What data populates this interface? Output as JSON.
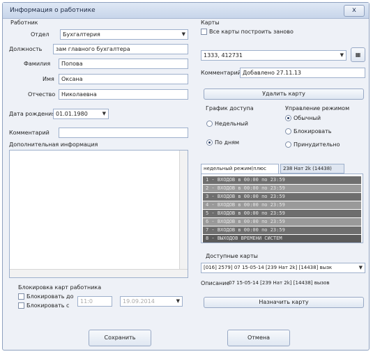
{
  "window": {
    "title": "Информация о работнике",
    "close_label": "x"
  },
  "left": {
    "section_label": "Работник",
    "department_label": "Отдел",
    "department_value": "Бухгалтерия",
    "position_label": "Должность",
    "position_value": "зам главного бухгалтера",
    "surname_label": "Фамилия",
    "surname_value": "Попова",
    "name_label": "Имя",
    "name_value": "Оксана",
    "patronymic_label": "Отчество",
    "patronymic_value": "Николаевна",
    "birthdate_label": "Дата рождения",
    "birthdate_value": "01.01.1980",
    "comment_label": "Комментарий",
    "comment_value": "",
    "extra_info_label": "Дополнительная информация",
    "extra_info_value": "",
    "block_section_label": "Блокировка карт работника",
    "block_until_label": "Блокировать до",
    "block_from_label": "Блокировать с",
    "block_time": "11:0",
    "block_date": "19.09.2014"
  },
  "right": {
    "cards_label": "Карты",
    "show_all_label": "Все карты построить заново",
    "card_value": "1333, 412731",
    "comment_label": "Комментарий",
    "comment_value": "Добавлено 27.11.13",
    "remove_card_label": "Удалить карту",
    "access_label": "График доступа",
    "radio_weekly_label": "Недельный",
    "radio_daily_label": "По дням",
    "control_label": "Управление режимом",
    "radio_normal_label": "Обычный",
    "radio_block_label": "Блокировать",
    "radio_free_label": "Принудительно",
    "tab1_label": "недельный режим(плюс",
    "tab2_label": "238 Нат 2k (14438)",
    "schedule_rows": [
      "1 - ВХОДОВ в 00:00 по 23:59",
      "2 - ВХОДОВ в 00:00 по 23:59",
      "3 - ВХОДОВ в 00:00 по 23:59",
      "4 - ВХОДОВ в 00:00 по 23:59",
      "5 - ВХОДОВ в 00:00 по 23:59",
      "6 - ВХОДОВ в 00:00 по 23:59",
      "7 - ВХОДОВ в 00:00 по 23:59",
      "8 - ВЫХОДОВ ВРЕМЕНИ СИСТЕМ"
    ],
    "available_cards_label": "Доступные карты",
    "available_value": "[016] 2579] 07 15-05-14 [239 Нат 2k] [14438] вызк",
    "description_label": "Описание",
    "description_value": "07 15-05-14 [239 Нат 2k] [14438] вызов",
    "assign_card_label": "Назначить карту"
  },
  "footer": {
    "save_label": "Сохранить",
    "cancel_label": "Отмена"
  }
}
